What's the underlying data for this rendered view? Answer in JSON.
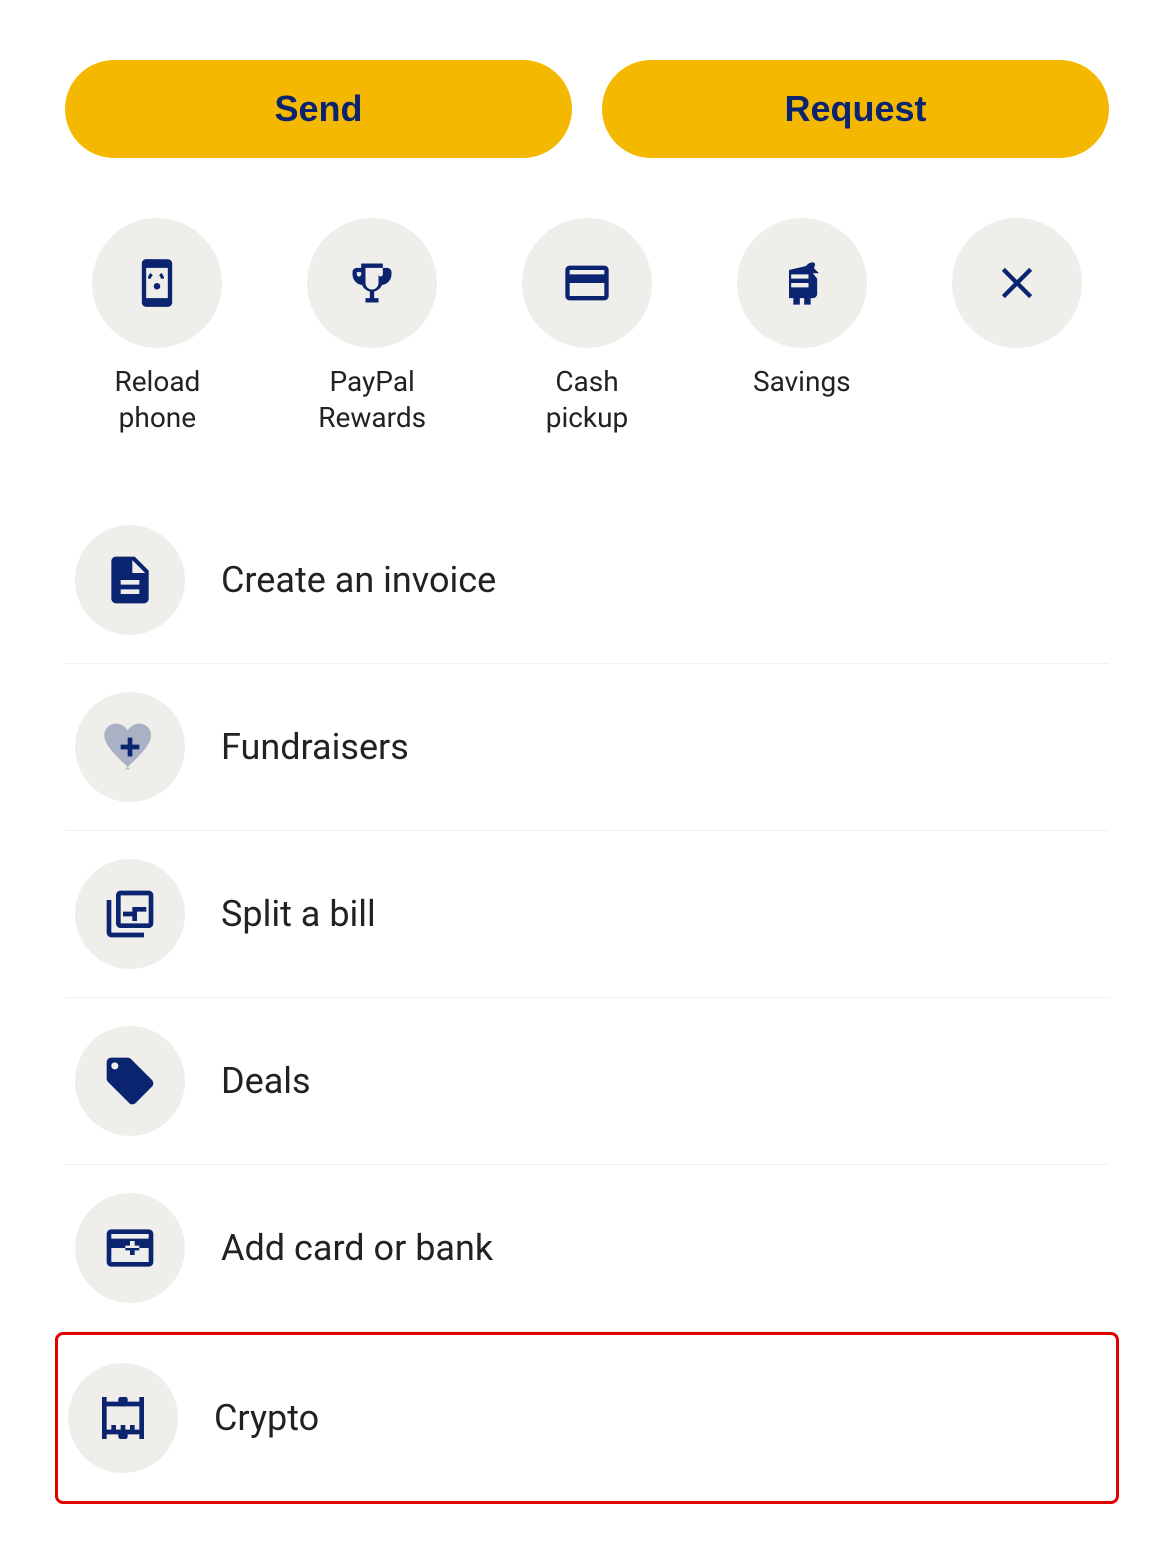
{
  "buttons": {
    "send_label": "Send",
    "request_label": "Request"
  },
  "quick_actions": [
    {
      "id": "reload-phone",
      "label": "Reload\nphone",
      "icon": "phone-reload"
    },
    {
      "id": "paypal-rewards",
      "label": "PayPal\nRewards",
      "icon": "trophy"
    },
    {
      "id": "cash-pickup",
      "label": "Cash\npickup",
      "icon": "cash-pickup"
    },
    {
      "id": "savings",
      "label": "Savings",
      "icon": "savings"
    },
    {
      "id": "close",
      "label": "",
      "icon": "close"
    }
  ],
  "list_items": [
    {
      "id": "create-invoice",
      "label": "Create an invoice",
      "icon": "invoice"
    },
    {
      "id": "fundraisers",
      "label": "Fundraisers",
      "icon": "fundraisers"
    },
    {
      "id": "split-bill",
      "label": "Split a bill",
      "icon": "split-bill"
    },
    {
      "id": "deals",
      "label": "Deals",
      "icon": "deals"
    },
    {
      "id": "add-card-bank",
      "label": "Add card or bank",
      "icon": "add-card"
    },
    {
      "id": "crypto",
      "label": "Crypto",
      "icon": "crypto",
      "highlighted": true
    }
  ]
}
